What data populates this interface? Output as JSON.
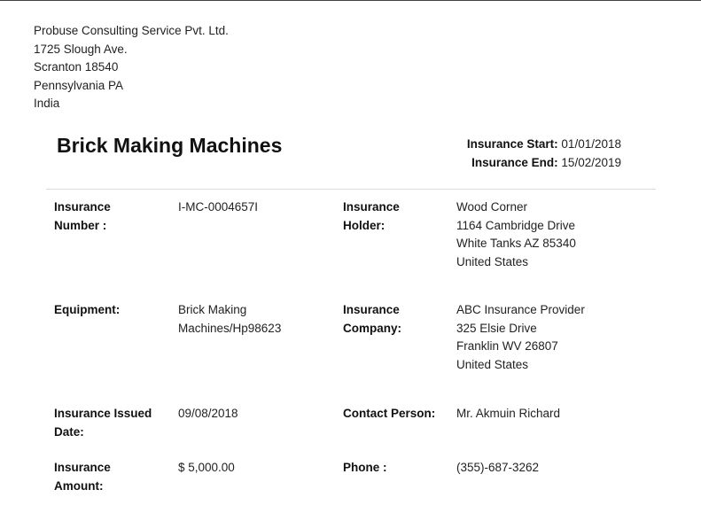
{
  "company": {
    "lines": [
      "Probuse Consulting Service Pvt. Ltd.",
      "1725 Slough Ave.",
      "Scranton 18540",
      "Pennsylvania PA",
      "India"
    ]
  },
  "title": "Brick Making Machines",
  "period": {
    "start_label": "Insurance Start:",
    "start_value": "01/01/2018",
    "end_label": "Insurance End:",
    "end_value": "15/02/2019"
  },
  "details": {
    "insurance_number": {
      "label_line1": "Insurance",
      "label_line2": "Number :",
      "value": "I-MC-0004657I"
    },
    "insurance_holder": {
      "label_line1": "Insurance",
      "label_line2": "Holder:",
      "lines": [
        "Wood Corner",
        "1164 Cambridge Drive",
        "White Tanks AZ 85340",
        "United States"
      ]
    },
    "equipment": {
      "label": "Equipment:",
      "lines": [
        "Brick Making",
        "Machines/Hp98623"
      ]
    },
    "insurance_company": {
      "label_line1": "Insurance",
      "label_line2": "Company:",
      "lines": [
        "ABC Insurance Provider",
        "325 Elsie Drive",
        "Franklin WV 26807",
        "United States"
      ]
    },
    "issued_date": {
      "label_line1": "Insurance Issued",
      "label_line2": "Date:",
      "value": "09/08/2018"
    },
    "contact_person": {
      "label": "Contact Person:",
      "value": "Mr. Akmuin Richard"
    },
    "insurance_amount": {
      "label_line1": "Insurance",
      "label_line2": "Amount:",
      "value": "$ 5,000.00"
    },
    "phone": {
      "label": "Phone :",
      "value": "(355)-687-3262"
    }
  }
}
